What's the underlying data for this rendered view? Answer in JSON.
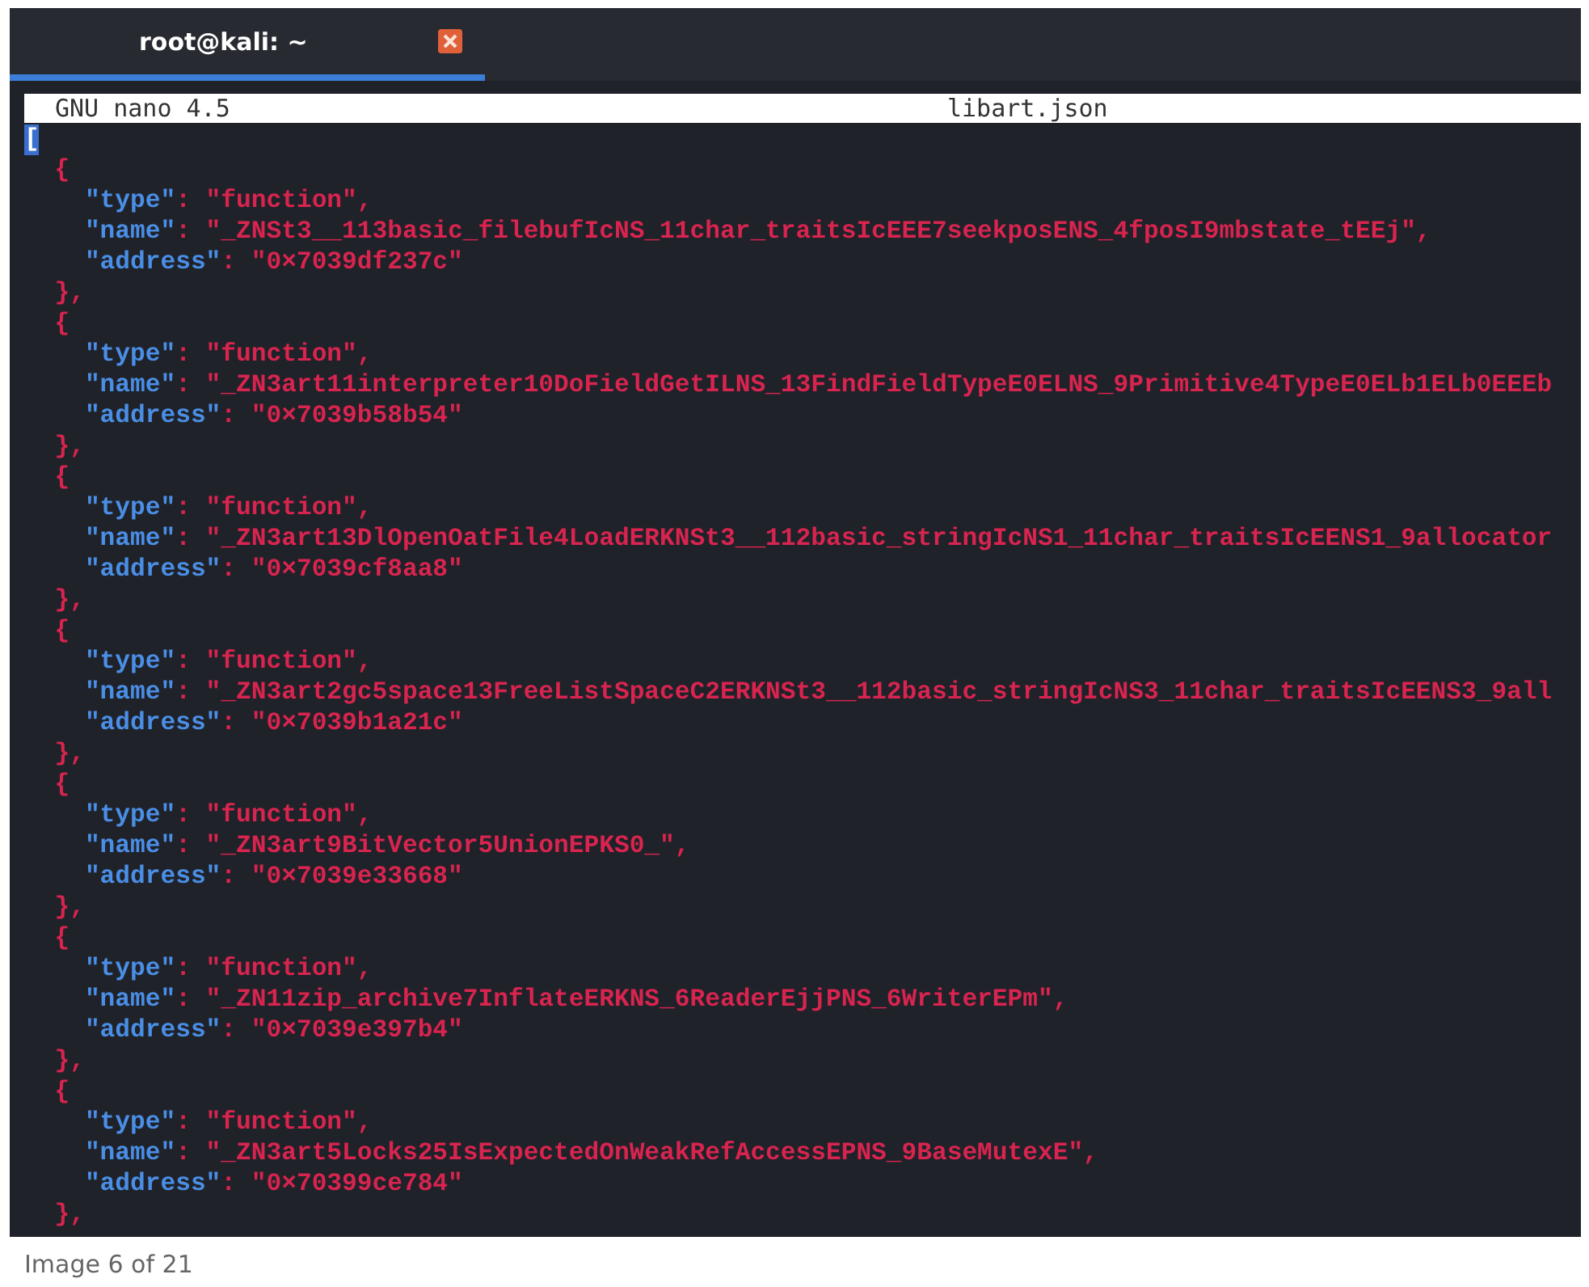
{
  "tab": {
    "title": "root@kali: ~",
    "selected": true
  },
  "editor": {
    "app": "GNU nano 4.5",
    "filename": "libart.json"
  },
  "code": {
    "open": "[",
    "cursor": true,
    "entries": [
      {
        "open": "{",
        "close": "},",
        "fields": [
          {
            "key": "\"type\"",
            "sep": ":",
            "value": "\"function\","
          },
          {
            "key": "\"name\"",
            "sep": ":",
            "value": "\"_ZNSt3__113basic_filebufIcNS_11char_traitsIcEEE7seekposENS_4fposI9mbstate_tEEj\","
          },
          {
            "key": "\"address\"",
            "sep": ":",
            "value": "\"0×7039df237c\""
          }
        ]
      },
      {
        "open": "{",
        "close": "},",
        "fields": [
          {
            "key": "\"type\"",
            "sep": ":",
            "value": "\"function\","
          },
          {
            "key": "\"name\"",
            "sep": ":",
            "value": "\"_ZN3art11interpreter10DoFieldGetILNS_13FindFieldTypeE0ELNS_9Primitive4TypeE0ELb1ELb0EEEb"
          },
          {
            "key": "\"address\"",
            "sep": ":",
            "value": "\"0×7039b58b54\""
          }
        ]
      },
      {
        "open": "{",
        "close": "},",
        "fields": [
          {
            "key": "\"type\"",
            "sep": ":",
            "value": "\"function\","
          },
          {
            "key": "\"name\"",
            "sep": ":",
            "value": "\"_ZN3art13DlOpenOatFile4LoadERKNSt3__112basic_stringIcNS1_11char_traitsIcEENS1_9allocator"
          },
          {
            "key": "\"address\"",
            "sep": ":",
            "value": "\"0×7039cf8aa8\""
          }
        ]
      },
      {
        "open": "{",
        "close": "},",
        "fields": [
          {
            "key": "\"type\"",
            "sep": ":",
            "value": "\"function\","
          },
          {
            "key": "\"name\"",
            "sep": ":",
            "value": "\"_ZN3art2gc5space13FreeListSpaceC2ERKNSt3__112basic_stringIcNS3_11char_traitsIcEENS3_9all"
          },
          {
            "key": "\"address\"",
            "sep": ":",
            "value": "\"0×7039b1a21c\""
          }
        ]
      },
      {
        "open": "{",
        "close": "},",
        "fields": [
          {
            "key": "\"type\"",
            "sep": ":",
            "value": "\"function\","
          },
          {
            "key": "\"name\"",
            "sep": ":",
            "value": "\"_ZN3art9BitVector5UnionEPKS0_\","
          },
          {
            "key": "\"address\"",
            "sep": ":",
            "value": "\"0×7039e33668\""
          }
        ]
      },
      {
        "open": "{",
        "close": "},",
        "fields": [
          {
            "key": "\"type\"",
            "sep": ":",
            "value": "\"function\","
          },
          {
            "key": "\"name\"",
            "sep": ":",
            "value": "\"_ZN11zip_archive7InflateERKNS_6ReaderEjjPNS_6WriterEPm\","
          },
          {
            "key": "\"address\"",
            "sep": ":",
            "value": "\"0×7039e397b4\""
          }
        ]
      },
      {
        "open": "{",
        "close": "},",
        "fields": [
          {
            "key": "\"type\"",
            "sep": ":",
            "value": "\"function\","
          },
          {
            "key": "\"name\"",
            "sep": ":",
            "value": "\"_ZN3art5Locks25IsExpectedOnWeakRefAccessEPNS_9BaseMutexE\","
          },
          {
            "key": "\"address\"",
            "sep": ":",
            "value": "\"0×70399ce784\""
          }
        ]
      }
    ]
  },
  "caption": "Image 6 of 21"
}
